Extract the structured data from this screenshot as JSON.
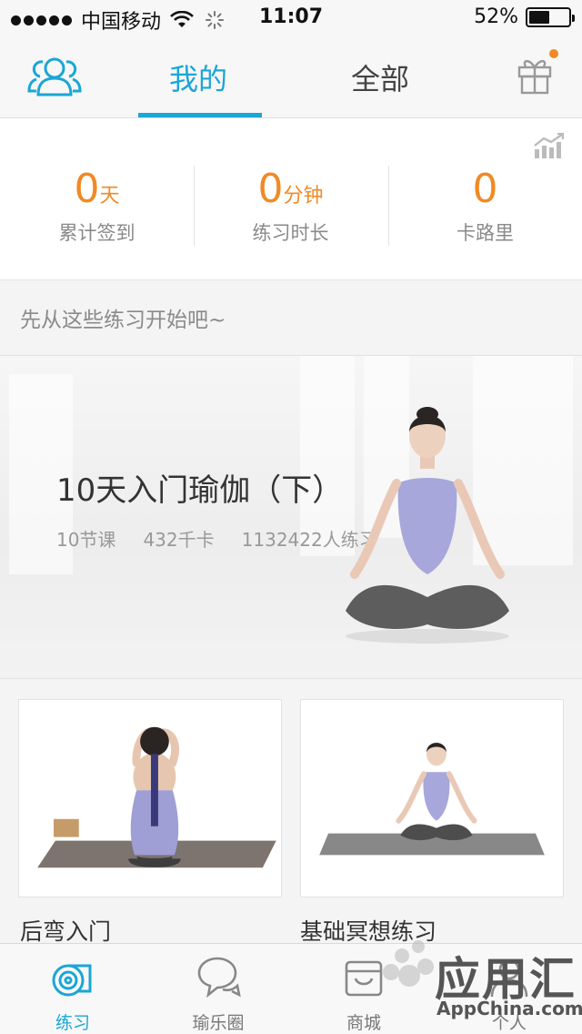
{
  "status_bar": {
    "carrier": "中国移动",
    "time": "11:07",
    "battery": "52%",
    "battery_level": 0.52
  },
  "header": {
    "tabs": [
      {
        "label": "我的",
        "active": true
      },
      {
        "label": "全部",
        "active": false
      }
    ],
    "icons": {
      "left": "users-icon",
      "right": "gift-icon"
    },
    "accent_color": "#1aa6d6",
    "notification_color": "#f08a24"
  },
  "stats": {
    "items": [
      {
        "value": "0",
        "unit": "天",
        "label": "累计签到"
      },
      {
        "value": "0",
        "unit": "分钟",
        "label": "练习时长"
      },
      {
        "value": "0",
        "unit": "",
        "label": "卡路里"
      }
    ],
    "value_color": "#f08a24"
  },
  "section": {
    "title": "先从这些练习开始吧~"
  },
  "featured": {
    "title": "10天入门瑜伽（下）",
    "lessons": "10节课",
    "calories": "432千卡",
    "participants": "1132422人练习"
  },
  "courses": [
    {
      "label": "后弯入门"
    },
    {
      "label": "基础冥想练习"
    }
  ],
  "tab_bar": {
    "items": [
      {
        "label": "练习",
        "icon": "yoga-mat-icon",
        "active": true
      },
      {
        "label": "瑜乐圈",
        "icon": "chat-bubbles-icon",
        "active": false
      },
      {
        "label": "商城",
        "icon": "shop-icon",
        "active": false
      },
      {
        "label": "个人",
        "icon": "profile-icon",
        "active": false
      }
    ]
  },
  "watermark": {
    "text": "应用汇",
    "sub": "AppChina.com"
  }
}
